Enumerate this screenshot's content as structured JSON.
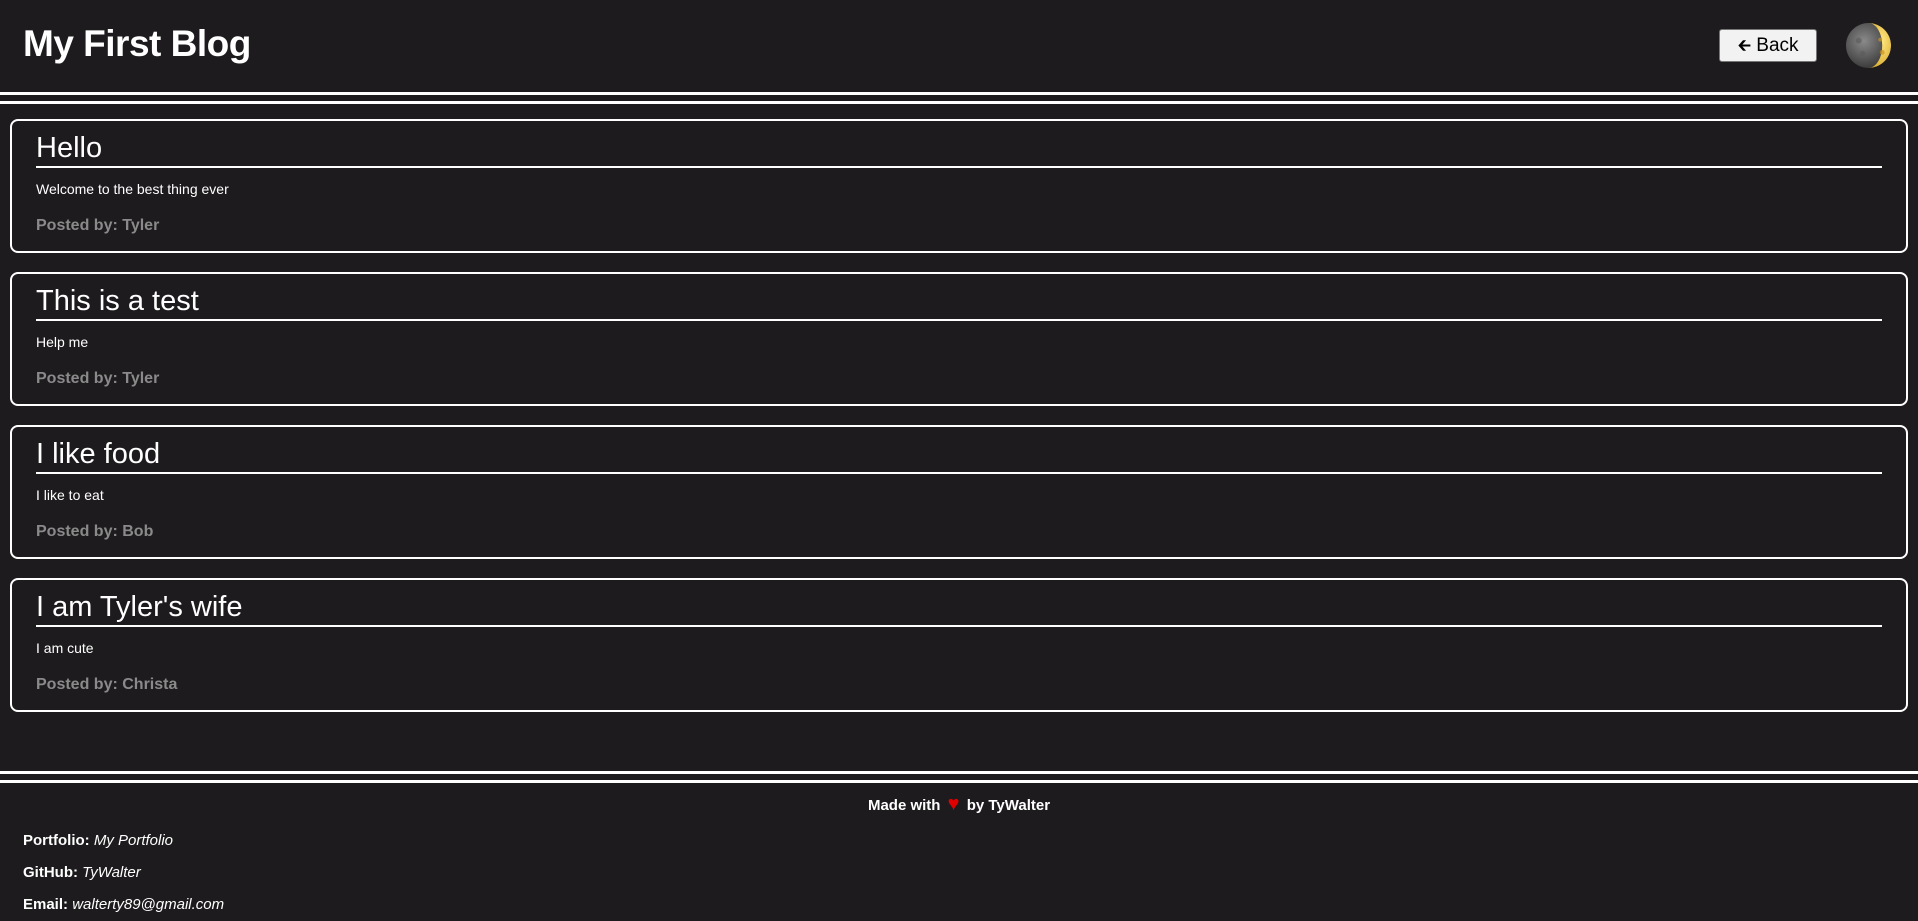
{
  "header": {
    "title": "My First Blog",
    "back_label": "Back",
    "back_icon": "left-arrow-icon",
    "theme_icon": "crescent-moon-icon"
  },
  "posts": [
    {
      "title": "Hello",
      "body": "Welcome to the best thing ever",
      "author": "Posted by: Tyler"
    },
    {
      "title": "This is a test",
      "body": "Help me",
      "author": "Posted by: Tyler"
    },
    {
      "title": "I like food",
      "body": "I like to eat",
      "author": "Posted by: Bob"
    },
    {
      "title": "I am Tyler's wife",
      "body": "I am cute",
      "author": "Posted by: Christa"
    }
  ],
  "footer": {
    "made_with_prefix": "Made with",
    "made_with_suffix": "by TyWalter",
    "heart_icon": "heart-icon",
    "links": [
      {
        "label": "Portfolio:",
        "value": "My Portfolio"
      },
      {
        "label": "GitHub:",
        "value": "TyWalter"
      },
      {
        "label": "Email:",
        "value": "walterty89@gmail.com"
      }
    ]
  },
  "colors": {
    "background": "#1d1b1d",
    "text": "#ffffff",
    "muted": "#8a8a8a",
    "heart": "#e00000",
    "moon": "#f2c94c"
  }
}
